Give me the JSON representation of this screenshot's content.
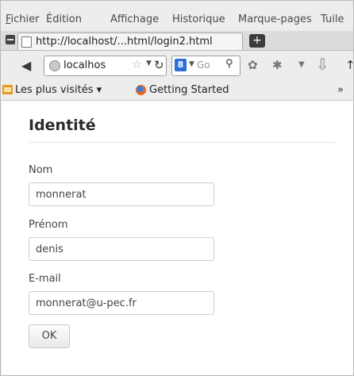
{
  "menu": {
    "items": [
      "Fichier",
      "Édition",
      "Affichage",
      "Historique",
      "Marque-pages",
      "Tuile"
    ]
  },
  "tab": {
    "label": "http://localhost/...html/login2.html",
    "new_tab": "+"
  },
  "navbar": {
    "url": "localhos",
    "search_placeholder": "Go",
    "search_engine": "8"
  },
  "bookmarks": {
    "most_visited": "Les plus visités ▾",
    "getting_started": "Getting Started",
    "more": "»"
  },
  "page": {
    "title": "Identité",
    "fields": [
      {
        "label": "Nom",
        "value": "monnerat"
      },
      {
        "label": "Prénom",
        "value": "denis"
      },
      {
        "label": "E-mail",
        "value": "monnerat@u-pec.fr"
      }
    ],
    "submit_label": "OK"
  }
}
